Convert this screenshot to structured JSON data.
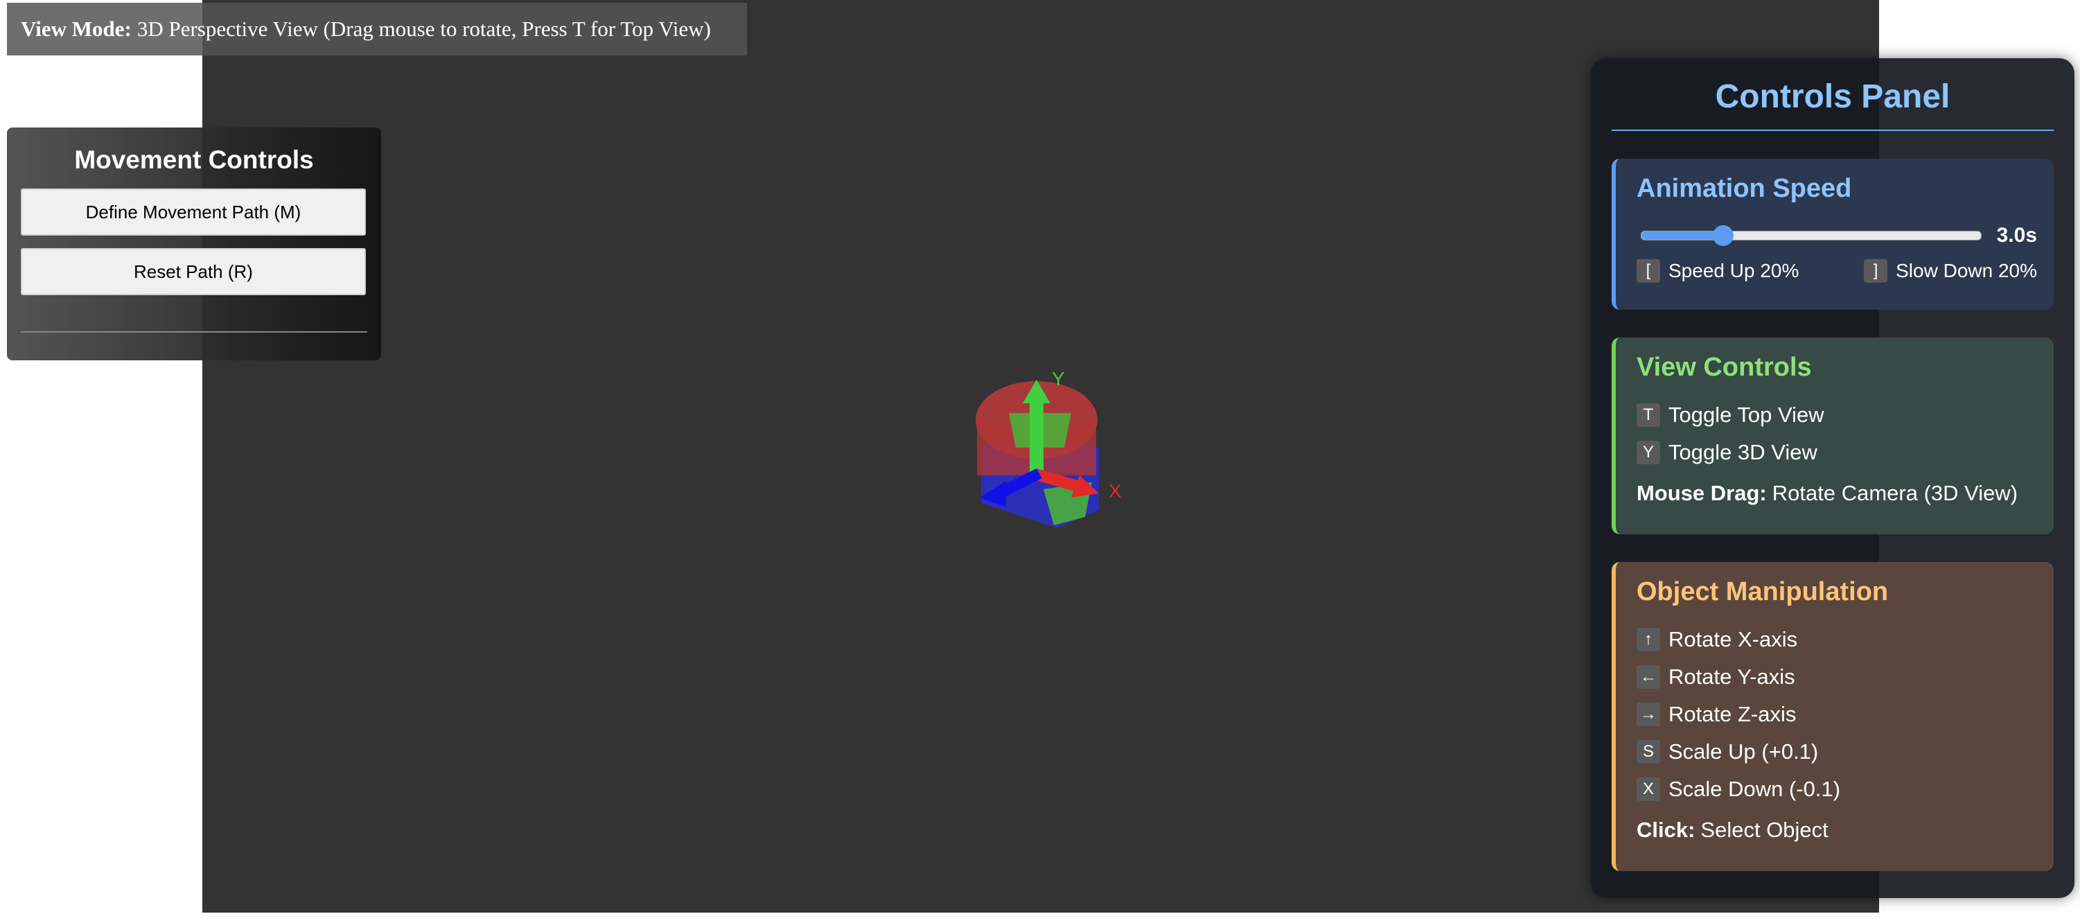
{
  "view_banner": {
    "label": "View Mode:",
    "text": "3D Perspective View (Drag mouse to rotate, Press T for Top View)"
  },
  "movement": {
    "title": "Movement Controls",
    "buttons": [
      "Define Movement Path (M)",
      "Reset Path (R)"
    ]
  },
  "controls": {
    "title": "Controls Panel",
    "animation": {
      "title": "Animation Speed",
      "value": "3.0s",
      "slider_fraction": 0.24,
      "speed_up_key": "[",
      "speed_up": "Speed Up 20%",
      "slow_down_key": "]",
      "slow_down": "Slow Down 20%"
    },
    "view": {
      "title": "View Controls",
      "items": [
        {
          "key": "T",
          "label": "Toggle Top View"
        },
        {
          "key": "Y",
          "label": "Toggle 3D View"
        }
      ],
      "note_label": "Mouse Drag:",
      "note_text": "Rotate Camera (3D View)"
    },
    "object": {
      "title": "Object Manipulation",
      "items": [
        {
          "key": "↑",
          "label": "Rotate X-axis"
        },
        {
          "key": "←",
          "label": "Rotate Y-axis"
        },
        {
          "key": "→",
          "label": "Rotate Z-axis"
        },
        {
          "key": "S",
          "label": "Scale Up (+0.1)"
        },
        {
          "key": "X",
          "label": "Scale Down (-0.1)"
        }
      ],
      "note_label": "Click:",
      "note_text": "Select Object"
    }
  },
  "scene": {
    "axis_y_label": "Y",
    "axis_x_label": "X"
  }
}
